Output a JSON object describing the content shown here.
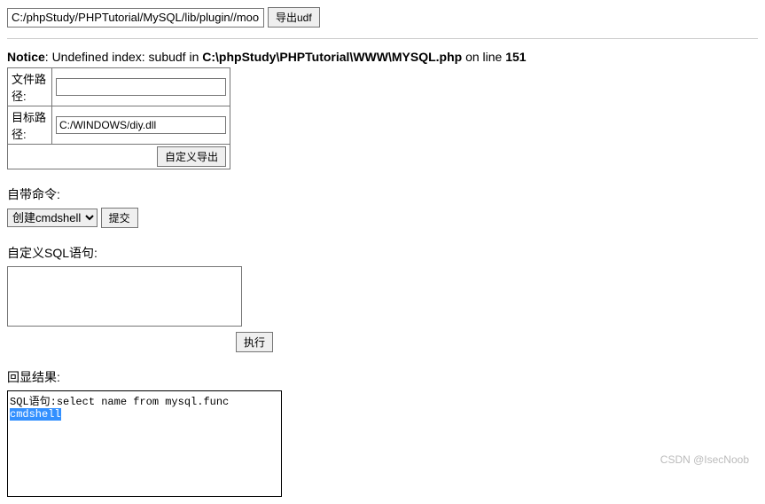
{
  "top": {
    "path_value": "C:/phpStudy/PHPTutorial/MySQL/lib/plugin//moonud",
    "export_btn": "导出udf"
  },
  "notice": {
    "prefix": "Notice",
    "text_1": ": Undefined index: subudf in ",
    "path": "C:\\phpStudy\\PHPTutorial\\WWW\\MYSQL.php",
    "text_2": " on line ",
    "line": "151"
  },
  "form": {
    "file_path_label": "文件路径:",
    "file_path_value": "",
    "target_path_label": "目标路径:",
    "target_path_value": "C:/WINDOWS/diy.dll",
    "custom_export_btn": "自定义导出"
  },
  "cmd": {
    "label": "自带命令:",
    "select_value": "创建cmdshell",
    "submit_btn": "提交"
  },
  "sql": {
    "label": "自定义SQL语句:",
    "textarea_value": "",
    "exec_btn": "执行"
  },
  "result": {
    "label": "回显结果:",
    "line1_prefix": "SQL语句:",
    "line1_query": "select name from mysql.func",
    "line2": "cmdshell"
  },
  "watermark": "CSDN @IsecNoob"
}
